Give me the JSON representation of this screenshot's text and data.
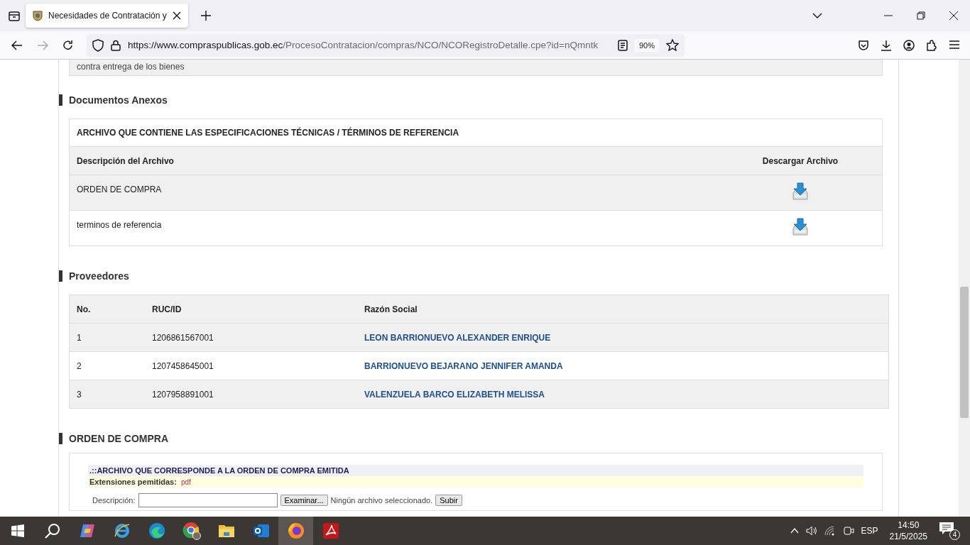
{
  "browser": {
    "tab_title": "Necesidades de Contratación y",
    "url_host": "https://www.compraspublicas.gob.ec",
    "url_path": "/ProcesoContratacion/compras/NCO/NCORegistroDetalle.cpe?id=nQmntk",
    "zoom": "90%"
  },
  "previous_section": {
    "text": "contra entrega de los bienes"
  },
  "documentos": {
    "heading": "Documentos Anexos",
    "table_title": "ARCHIVO QUE CONTIENE LAS ESPECIFICACIONES TÉCNICAS / TÉRMINOS DE REFERENCIA",
    "columns": [
      "Descripción del Archivo",
      "Descargar Archivo"
    ],
    "rows": [
      {
        "description": "ORDEN DE COMPRA"
      },
      {
        "description": "terminos de referencia"
      }
    ]
  },
  "proveedores": {
    "heading": "Proveedores",
    "columns": [
      "No.",
      "RUC/ID",
      "Razón Social"
    ],
    "rows": [
      {
        "no": "1",
        "ruc": "1206861567001",
        "razon_social": "LEON BARRIONUEVO ALEXANDER ENRIQUE"
      },
      {
        "no": "2",
        "ruc": "1207458645001",
        "razon_social": "BARRIONUEVO BEJARANO JENNIFER AMANDA"
      },
      {
        "no": "3",
        "ruc": "1207958891001",
        "razon_social": "VALENZUELA BARCO ELIZABETH MELISSA"
      }
    ]
  },
  "orden": {
    "heading": "ORDEN DE COMPRA",
    "banner": ".::ARCHIVO QUE CORRESPONDE A LA ORDEN DE COMPRA EMITIDA",
    "extensions_label": "Extensiones pemitidas:",
    "extensions_value": "pdf",
    "description_label": "Descripción:",
    "browse_button": "Examinar...",
    "file_status": "Ningún archivo seleccionado.",
    "upload_button": "Subir"
  },
  "taskbar": {
    "language": "ESP",
    "time": "14:50",
    "date": "21/5/2025",
    "notifications": "4"
  }
}
